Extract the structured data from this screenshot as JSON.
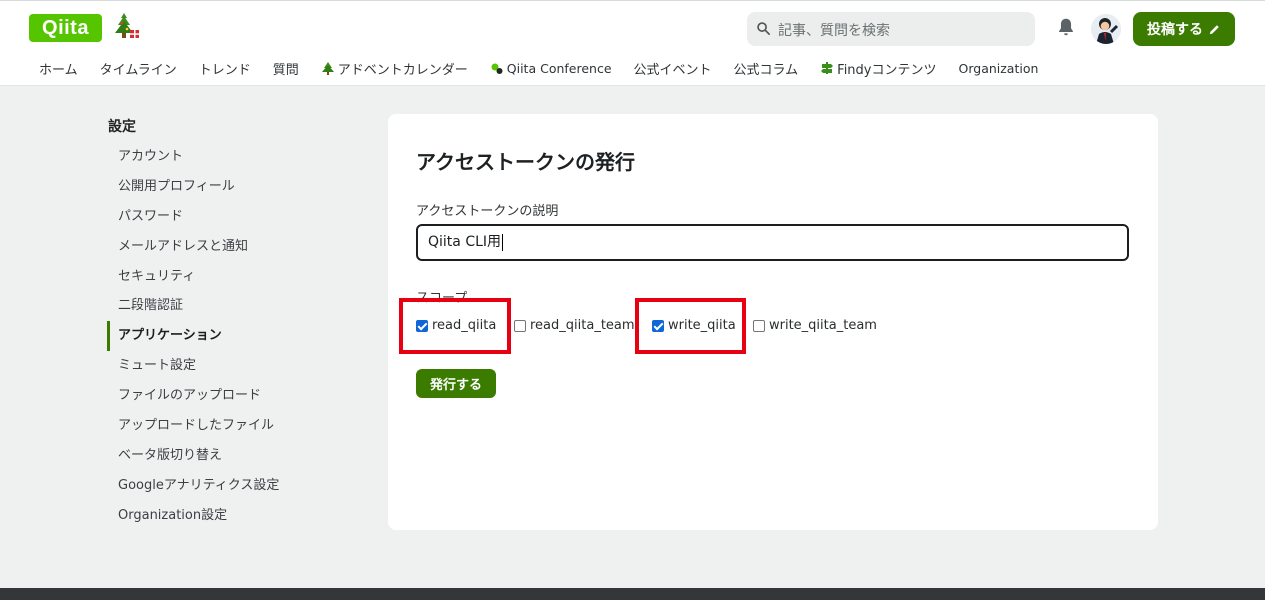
{
  "header": {
    "logo_text": "Qiita",
    "search_placeholder": "記事、質問を検索",
    "post_button_label": "投稿する"
  },
  "nav": {
    "items": [
      "ホーム",
      "タイムライン",
      "トレンド",
      "質問",
      "アドベントカレンダー",
      "Qiita Conference",
      "公式イベント",
      "公式コラム",
      "Findyコンテンツ",
      "Organization"
    ]
  },
  "sidebar": {
    "title": "設定",
    "items": [
      "アカウント",
      "公開用プロフィール",
      "パスワード",
      "メールアドレスと通知",
      "セキュリティ",
      "二段階認証",
      "アプリケーション",
      "ミュート設定",
      "ファイルのアップロード",
      "アップロードしたファイル",
      "ベータ版切り替え",
      "Googleアナリティクス設定",
      "Organization設定"
    ],
    "active_item": "アプリケーション"
  },
  "form": {
    "title": "アクセストークンの発行",
    "description_label": "アクセストークンの説明",
    "description_value": "Qiita CLI用",
    "scope_label": "スコープ",
    "scopes": [
      {
        "label": "read_qiita",
        "checked": true
      },
      {
        "label": "read_qiita_team",
        "checked": false
      },
      {
        "label": "write_qiita",
        "checked": true
      },
      {
        "label": "write_qiita_team",
        "checked": false
      }
    ],
    "submit_label": "発行する"
  },
  "colors": {
    "brand_green": "#55c500",
    "button_green": "#3a7b00",
    "highlight_red": "#e60012",
    "checkbox_blue": "#0f67d7"
  }
}
